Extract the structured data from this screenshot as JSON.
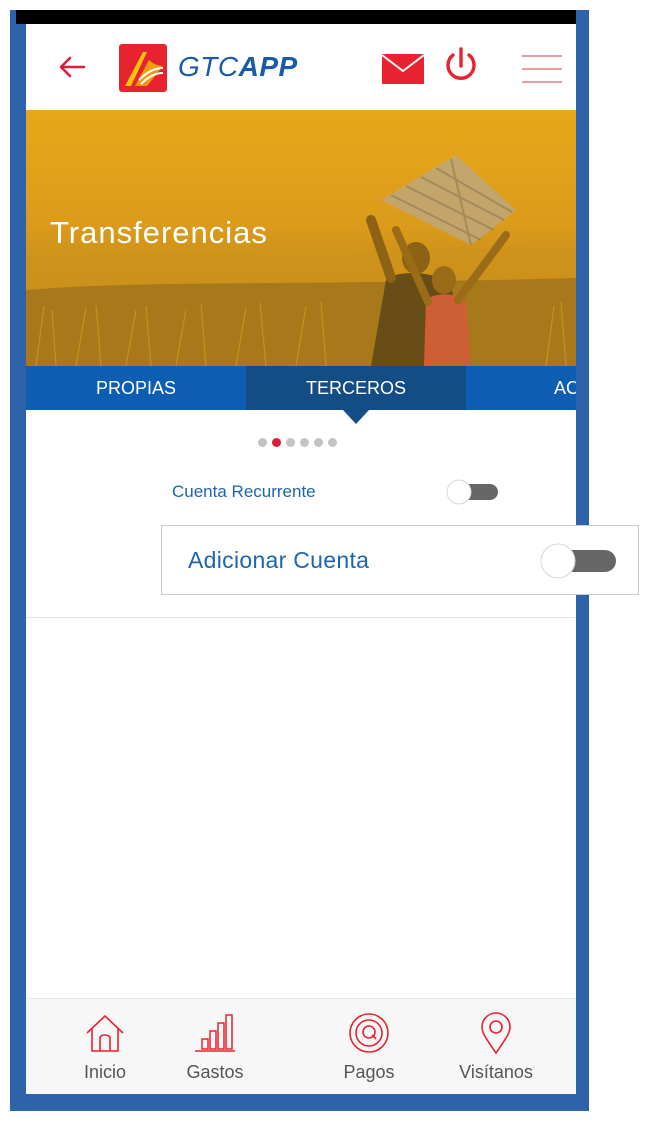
{
  "header": {
    "logo_text_light": "GTC",
    "logo_text_bold": "APP",
    "icons": [
      "back-arrow-icon",
      "gtc-logo-icon",
      "mail-icon",
      "power-icon",
      "menu-icon"
    ]
  },
  "hero": {
    "title": "Transferencias"
  },
  "tabs": [
    {
      "label": "PROPIAS",
      "active": false
    },
    {
      "label": "TERCEROS",
      "active": true
    },
    {
      "label": "AC",
      "active": false
    }
  ],
  "pagination": {
    "total": 6,
    "active_index": 1
  },
  "form": {
    "recurrente": {
      "label": "Cuenta Recurrente",
      "enabled": false
    },
    "adicionar": {
      "label": "Adicionar Cuenta",
      "enabled": false
    }
  },
  "bottom_nav": [
    {
      "label": "Inicio",
      "icon": "home-icon"
    },
    {
      "label": "Gastos",
      "icon": "bar-chart-icon"
    },
    {
      "label": "Pagos",
      "icon": "pay-icon"
    },
    {
      "label": "Visítanos",
      "icon": "location-pin-icon"
    }
  ],
  "colors": {
    "brand_blue": "#1d65ad",
    "tab_blue": "#0d5eb3",
    "tab_active": "#144c86",
    "accent_red": "#d81e3a",
    "frame_blue": "#2e62aa",
    "hero_gold": "#e8a81a",
    "switch_track": "#666666"
  }
}
